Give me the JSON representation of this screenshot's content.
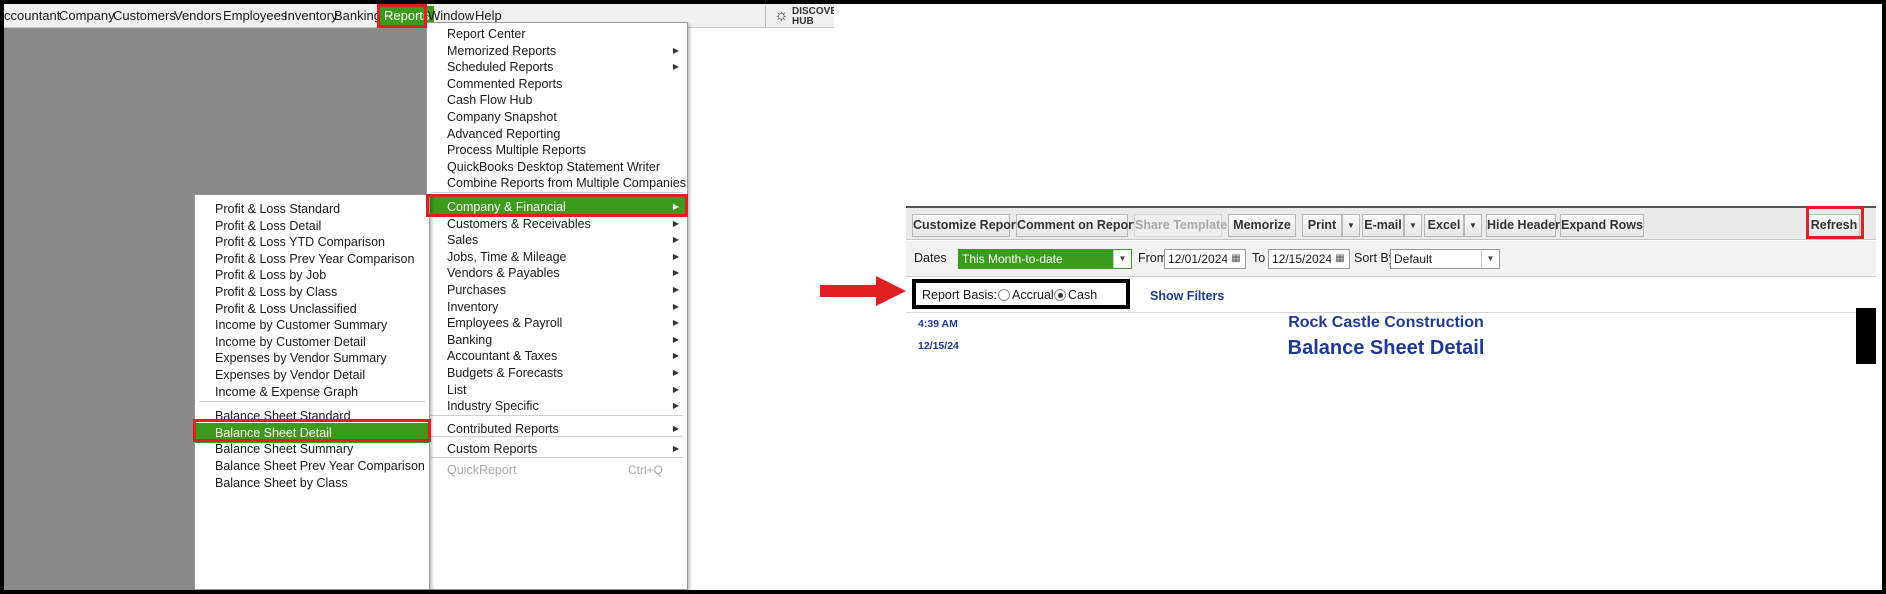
{
  "menubar": {
    "items": [
      "ccountant",
      "Company",
      "Customers",
      "Vendors",
      "Employees",
      "Inventory",
      "Banking",
      "Reports",
      "Window",
      "Help"
    ],
    "active": "Reports",
    "hub_label": "DISCOVER HUB"
  },
  "reports_menu": {
    "items": [
      {
        "label": "Report Center",
        "submenu": false
      },
      {
        "label": "Memorized Reports",
        "submenu": true
      },
      {
        "label": "Scheduled Reports",
        "submenu": true
      },
      {
        "label": "Commented Reports",
        "submenu": false
      },
      {
        "label": "Cash Flow Hub",
        "submenu": false
      },
      {
        "label": "Company Snapshot",
        "submenu": false
      },
      {
        "label": "Advanced Reporting",
        "submenu": false
      },
      {
        "label": "Process Multiple Reports",
        "submenu": false
      },
      {
        "label": "QuickBooks Desktop Statement Writer",
        "submenu": false
      },
      {
        "label": "Combine Reports from Multiple Companies",
        "submenu": false
      },
      {
        "label": "Company & Financial",
        "submenu": true,
        "selected": true
      },
      {
        "label": "Customers & Receivables",
        "submenu": true
      },
      {
        "label": "Sales",
        "submenu": true
      },
      {
        "label": "Jobs, Time & Mileage",
        "submenu": true
      },
      {
        "label": "Vendors & Payables",
        "submenu": true
      },
      {
        "label": "Purchases",
        "submenu": true
      },
      {
        "label": "Inventory",
        "submenu": true
      },
      {
        "label": "Employees & Payroll",
        "submenu": true
      },
      {
        "label": "Banking",
        "submenu": true
      },
      {
        "label": "Accountant & Taxes",
        "submenu": true
      },
      {
        "label": "Budgets & Forecasts",
        "submenu": true
      },
      {
        "label": "List",
        "submenu": true
      },
      {
        "label": "Industry Specific",
        "submenu": true
      },
      {
        "label": "Contributed Reports",
        "submenu": true
      },
      {
        "label": "Custom Reports",
        "submenu": true
      },
      {
        "label": "QuickReport",
        "submenu": false,
        "disabled": true,
        "shortcut": "Ctrl+Q"
      }
    ]
  },
  "company_financial_menu": {
    "items": [
      {
        "label": "Profit & Loss Standard"
      },
      {
        "label": "Profit & Loss Detail"
      },
      {
        "label": "Profit & Loss YTD Comparison"
      },
      {
        "label": "Profit & Loss Prev Year Comparison"
      },
      {
        "label": "Profit & Loss by Job"
      },
      {
        "label": "Profit & Loss by Class"
      },
      {
        "label": "Profit & Loss Unclassified"
      },
      {
        "label": "Income by Customer Summary"
      },
      {
        "label": "Income by Customer Detail"
      },
      {
        "label": "Expenses by Vendor Summary"
      },
      {
        "label": "Expenses by Vendor Detail"
      },
      {
        "label": "Income & Expense Graph"
      },
      {
        "label": "Balance Sheet Standard"
      },
      {
        "label": "Balance Sheet Detail",
        "selected": true
      },
      {
        "label": "Balance Sheet Summary"
      },
      {
        "label": "Balance Sheet Prev Year Comparison"
      },
      {
        "label": "Balance Sheet by Class"
      }
    ]
  },
  "report": {
    "toolbar": {
      "customize": "Customize Report",
      "comment": "Comment on Report",
      "share": "Share Template",
      "memorize": "Memorize",
      "print": "Print",
      "email": "E-mail",
      "excel": "Excel",
      "hide_header": "Hide Header",
      "expand_rows": "Expand Rows",
      "refresh": "Refresh"
    },
    "filters": {
      "dates_label": "Dates",
      "dates_value": "This Month-to-date",
      "from_label": "From",
      "from_value": "12/01/2024",
      "to_label": "To",
      "to_value": "12/15/2024",
      "sortby_label": "Sort By",
      "sortby_value": "Default"
    },
    "basis": {
      "label": "Report Basis:",
      "accrual": "Accrual",
      "cash": "Cash",
      "selected": "Cash"
    },
    "show_filters": "Show Filters",
    "time": "4:39 AM",
    "date": "12/15/24",
    "company": "Rock Castle Construction",
    "title": "Balance Sheet Detail"
  },
  "colors": {
    "highlight_green": "#3c9a1c",
    "annotation_red": "#e02020",
    "report_blue": "#1f3a93"
  }
}
